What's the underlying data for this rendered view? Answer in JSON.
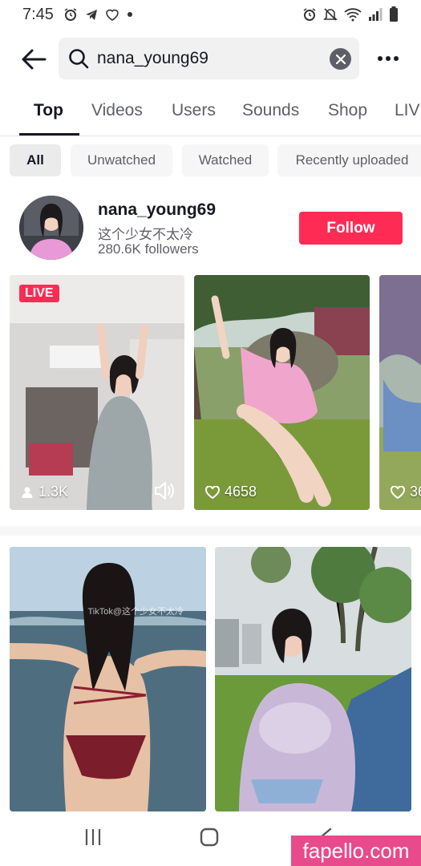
{
  "status_bar": {
    "time": "7:45"
  },
  "search": {
    "query": "nana_young69"
  },
  "tabs": [
    {
      "label": "Top",
      "active": true
    },
    {
      "label": "Videos"
    },
    {
      "label": "Users"
    },
    {
      "label": "Sounds"
    },
    {
      "label": "Shop"
    },
    {
      "label": "LIV"
    }
  ],
  "filters": [
    {
      "label": "All",
      "active": true
    },
    {
      "label": "Unwatched"
    },
    {
      "label": "Watched"
    },
    {
      "label": "Recently uploaded"
    }
  ],
  "user": {
    "username": "nana_young69",
    "nickname": "这个少女不太冷",
    "followers": "280.6K followers",
    "follow_label": "Follow"
  },
  "carousel": [
    {
      "badge": "LIVE",
      "stat": "1.3K",
      "stat_icon": "person-icon",
      "muted_icon": "speaker-icon"
    },
    {
      "stat": "4658",
      "stat_icon": "heart-icon"
    },
    {
      "stat": "36",
      "stat_icon": "heart-icon"
    }
  ],
  "grid": [
    {
      "watermark": "TikTok@这个少女不太冷"
    },
    {}
  ],
  "watermark_site": "fapello.com",
  "colors": {
    "accent": "#fe2c55",
    "text": "#161823",
    "secondary": "#5e5f66"
  }
}
